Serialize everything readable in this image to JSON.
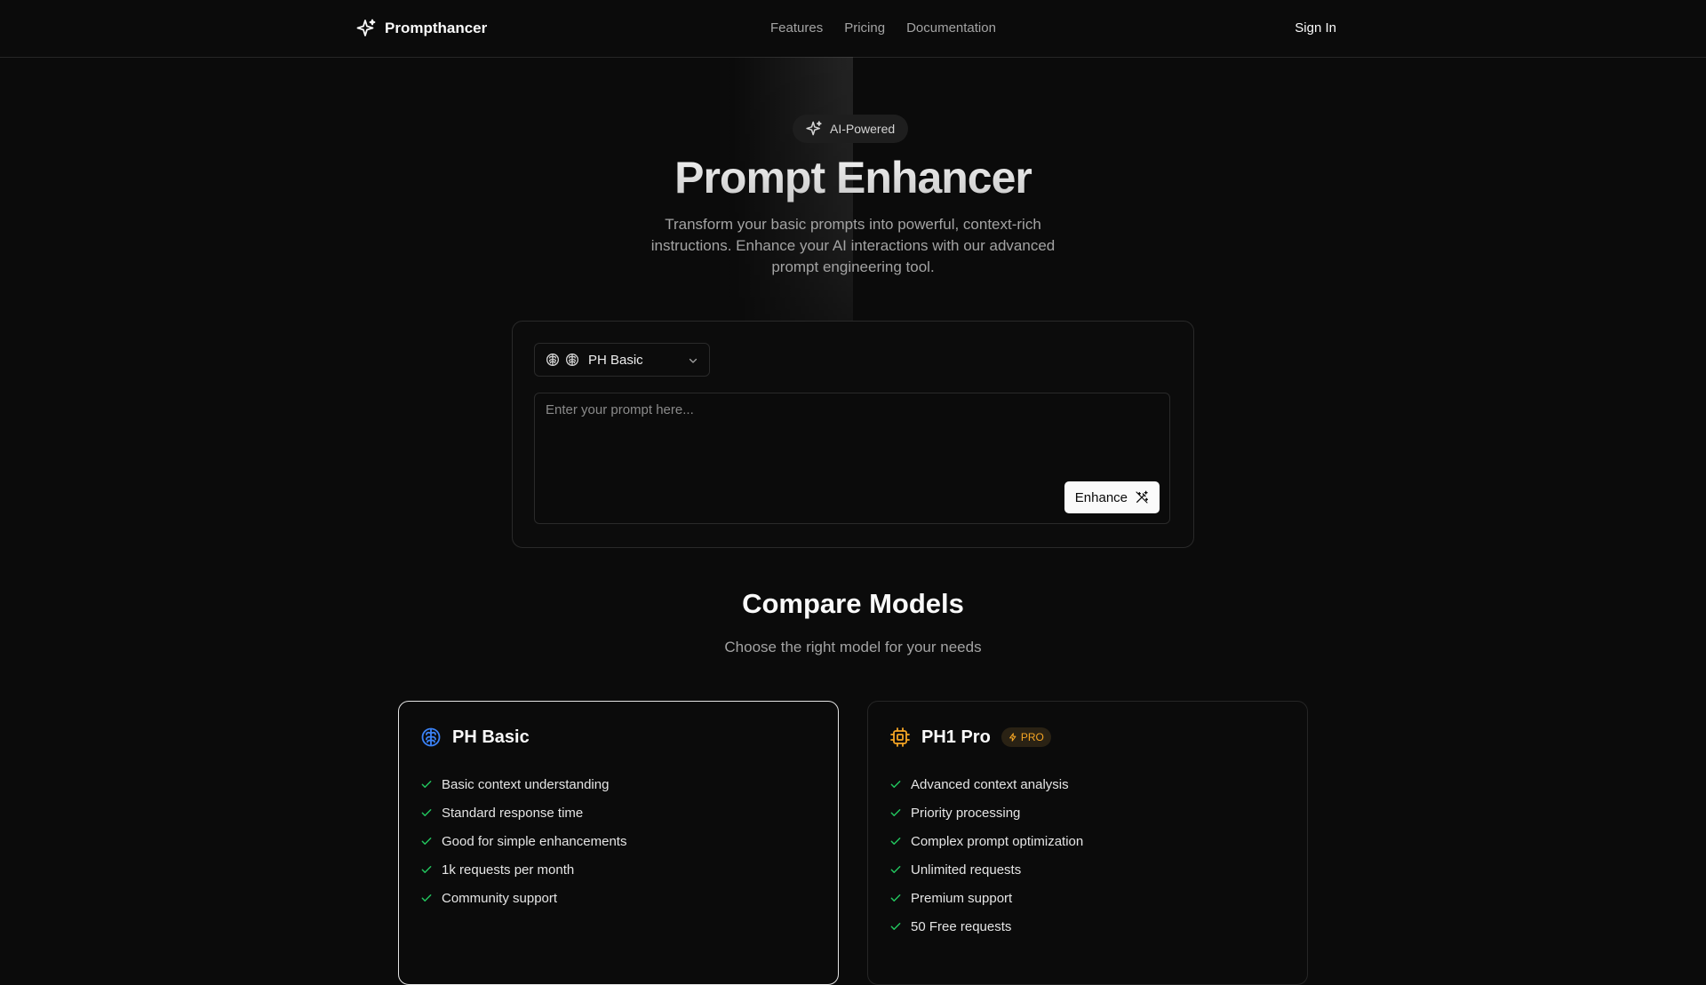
{
  "header": {
    "brand": "Prompthancer",
    "nav": [
      {
        "label": "Features"
      },
      {
        "label": "Pricing"
      },
      {
        "label": "Documentation"
      }
    ],
    "sign_in": "Sign In"
  },
  "hero": {
    "badge": "AI-Powered",
    "title": "Prompt Enhancer",
    "description": "Transform your basic prompts into powerful, context-rich instructions. Enhance your AI interactions with our advanced prompt engineering tool."
  },
  "prompt_card": {
    "model_select_value": "PH Basic",
    "input_placeholder": "Enter your prompt here...",
    "input_value": "",
    "enhance_label": "Enhance"
  },
  "compare": {
    "title": "Compare Models",
    "subtitle": "Choose the right model for your needs",
    "models": [
      {
        "name": "PH Basic",
        "icon": "brain-icon",
        "selected": true,
        "features": [
          "Basic context understanding",
          "Standard response time",
          "Good for simple enhancements",
          "1k requests per month",
          "Community support"
        ]
      },
      {
        "name": "PH1 Pro",
        "icon": "cpu-icon",
        "badge": "PRO",
        "selected": false,
        "features": [
          "Advanced context analysis",
          "Priority processing",
          "Complex prompt optimization",
          "Unlimited requests",
          "Premium support",
          "50 Free requests"
        ]
      }
    ]
  },
  "colors": {
    "background": "#0b0b0b",
    "border": "#262626",
    "check": "#22c55e",
    "basic_icon": "#3b82f6",
    "pro_icon": "#f5a524"
  }
}
